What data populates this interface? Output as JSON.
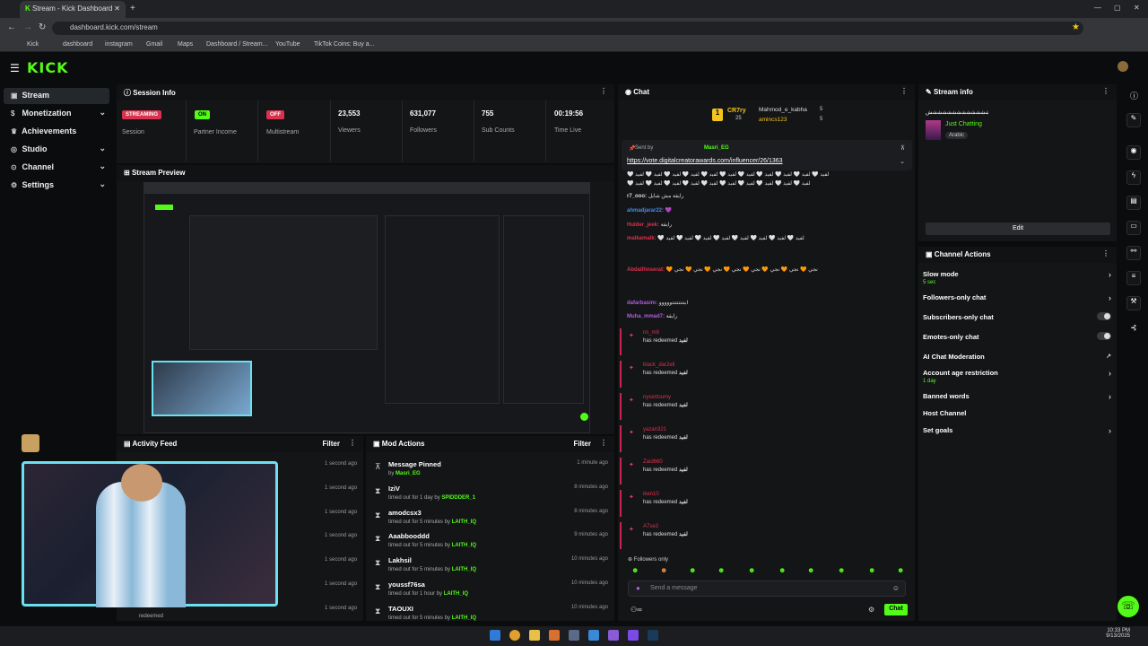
{
  "browser": {
    "tab_title": "Stream - Kick Dashboard",
    "url": "dashboard.kick.com/stream",
    "bookmarks": [
      "Kick",
      "dashboard",
      "instagram",
      "Gmail",
      "Maps",
      "Dashboard / Stream...",
      "YouTube",
      "TikTok Coins: Buy a..."
    ]
  },
  "brand": {
    "logo": "KICK",
    "accent": "#53fc18"
  },
  "sidebar": {
    "items": [
      {
        "label": "Stream",
        "icon": "video-icon",
        "active": true
      },
      {
        "label": "Monetization",
        "icon": "dollar-icon"
      },
      {
        "label": "Achievements",
        "icon": "trophy-icon"
      },
      {
        "label": "Studio",
        "icon": "studio-icon"
      },
      {
        "label": "Channel",
        "icon": "channel-icon"
      },
      {
        "label": "Settings",
        "icon": "gear-icon"
      }
    ]
  },
  "session": {
    "title": "Session Info",
    "stats": [
      {
        "value": "STREAMING",
        "label": "Session"
      },
      {
        "value": "ON",
        "label": "Partner Income"
      },
      {
        "value": "OFF",
        "label": "Multistream"
      },
      {
        "value": "23,553",
        "label": "Viewers"
      },
      {
        "value": "631,077",
        "label": "Followers"
      },
      {
        "value": "755",
        "label": "Sub Counts"
      },
      {
        "value": "00:19:56",
        "label": "Time Live"
      }
    ]
  },
  "preview": {
    "title": "Stream Preview"
  },
  "activity": {
    "title": "Activity Feed",
    "filter": "Filter",
    "times": [
      "1 second ago",
      "1 second ago",
      "1 second ago",
      "1 second ago",
      "1 second ago",
      "1 second ago",
      "1 second ago"
    ],
    "footer_user": "redeemed"
  },
  "mod": {
    "title": "Mod Actions",
    "filter": "Filter",
    "items": [
      {
        "title": "Message Pinned",
        "detail": "by",
        "by": "Masri_EG",
        "time": "1 minute ago",
        "icon": "pin-icon"
      },
      {
        "title": "IziV",
        "detail": "timed out for 1 day by",
        "by": "SPIDDDER_1",
        "time": "8 minutes ago",
        "icon": "hourglass-icon"
      },
      {
        "title": "amodcsx3",
        "detail": "timed out for 5 minutes by",
        "by": "LAITH_IQ",
        "time": "8 minutes ago",
        "icon": "hourglass-icon"
      },
      {
        "title": "Aaabbooddd",
        "detail": "timed out for 5 minutes by",
        "by": "LAITH_IQ",
        "time": "9 minutes ago",
        "icon": "hourglass-icon"
      },
      {
        "title": "Lakhsil",
        "detail": "timed out for 5 minutes by",
        "by": "LAITH_IQ",
        "time": "10 minutes ago",
        "icon": "hourglass-icon"
      },
      {
        "title": "youssf76sa",
        "detail": "timed out for 1 hour by",
        "by": "LAITH_IQ",
        "time": "10 minutes ago",
        "icon": "hourglass-icon"
      },
      {
        "title": "TAOUXI",
        "detail": "timed out for 5 minutes by",
        "by": "LAITH_IQ",
        "time": "10 minutes ago",
        "icon": "hourglass-icon"
      }
    ]
  },
  "chat": {
    "title": "Chat",
    "top_gifters": [
      {
        "rank": "1",
        "name": "CR7ry",
        "count": "25"
      },
      {
        "name": "Mahmod_e_kabha",
        "count": "5"
      },
      {
        "name": "amincs123",
        "count": "5"
      }
    ],
    "pinned": {
      "sent_by_label": "Sent by",
      "sender": "Masri_EG",
      "link": "https://vote.digitalcreatorawards.com/influencer/26/1363"
    },
    "lines": [
      {
        "user": "",
        "text": "🤍 لفيد 🤍 لفيد 🤍 لفيد 🤍 لفيد 🤍 لفيد 🤍 لفيد 🤍 لفيد 🤍 لفيد 🤍 لفيد 🤍 لفيد 🤍 لفيد"
      },
      {
        "user": "",
        "text": "🤍 لفيد 🤍 لفيد 🤍 لفيد 🤍 لفيد 🤍 لفيد 🤍 لفيد 🤍 لفيد 🤍 لفيد 🤍 لفيد 🤍 لفيد"
      },
      {
        "user": "r7_ooo:",
        "text": "رايقة مش شايل"
      },
      {
        "user": "ahmadjarar22:",
        "text": "💜"
      },
      {
        "user": "Hulder_jeek:",
        "text": "رايقة"
      },
      {
        "user": "malkamalk:",
        "text": "🤍 لفيد 🤍 لفيد 🤍 لفيد 🤍 لفيد 🤍 لفيد 🤍 لفيد 🤍 لفيد 🤍 لفيد"
      },
      {
        "user": "Abdallhnserat:",
        "text": "🧡 نجي 🧡 نجي 🧡 نجي 🧡 نجي 🧡 نجي 🧡 نجي 🧡 نجي 🧡 نجي"
      },
      {
        "user": "dafarbasim:",
        "text": "ابتتتتتتتتووووو"
      },
      {
        "user": "Muha_mmad7:",
        "text": "رايقة"
      }
    ],
    "redeems": [
      {
        "user": "ns_m9",
        "message": "has redeemed",
        "reward": "لفيد"
      },
      {
        "user": "black_dar2ell",
        "message": "has redeemed",
        "reward": "لفيد"
      },
      {
        "user": "nysertoumy",
        "message": "has redeemed",
        "reward": "لفيد"
      },
      {
        "user": "yazan321",
        "message": "has redeemed",
        "reward": "لفيد"
      },
      {
        "user": "Zaid660",
        "message": "has redeemed",
        "reward": "لفيد"
      },
      {
        "user": "iken10",
        "message": "has redeemed",
        "reward": "لفيد"
      },
      {
        "user": "A7se3",
        "message": "has redeemed",
        "reward": "لفيد"
      }
    ],
    "mode": "Followers only",
    "placeholder": "Send a message",
    "send_label": "Chat"
  },
  "stream_info": {
    "title": "Stream info",
    "stream_title": "شششششششششششششششششش",
    "category": "Just Chatting",
    "tag": "Arabic",
    "edit_label": "Edit"
  },
  "channel_actions": {
    "title": "Channel Actions",
    "items": [
      {
        "label": "Slow mode",
        "sub": "5 sec",
        "control": "arrow"
      },
      {
        "label": "Followers-only chat",
        "sub": "",
        "control": "arrow"
      },
      {
        "label": "Subscribers-only chat",
        "sub": "",
        "control": "toggle"
      },
      {
        "label": "Emotes-only chat",
        "sub": "",
        "control": "toggle"
      },
      {
        "label": "AI Chat Moderation",
        "sub": "",
        "control": "external"
      },
      {
        "label": "Account age restriction",
        "sub": "1 day",
        "control": "arrow"
      },
      {
        "label": "Banned words",
        "sub": "",
        "control": "arrow"
      },
      {
        "label": "Host Channel",
        "sub": "",
        "control": "none"
      },
      {
        "label": "Set goals",
        "sub": "",
        "control": "arrow"
      }
    ]
  },
  "taskbar": {
    "time": "10:33 PM",
    "date": "9/13/2025"
  }
}
